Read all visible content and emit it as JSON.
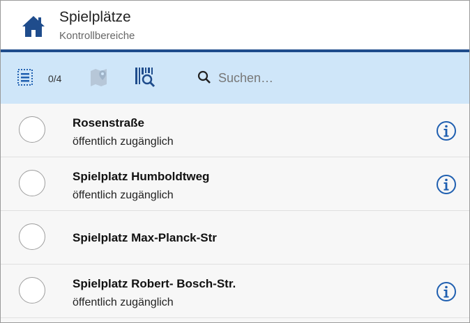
{
  "header": {
    "title": "Spielplätze",
    "subtitle": "Kontrollbereiche",
    "icon": "home-icon",
    "brand_color": "#1f4c8c"
  },
  "toolbar": {
    "counter": "0/4",
    "search_placeholder": "Suchen…",
    "background": "#cfe6f9",
    "icons": [
      "list-select-icon",
      "map-marker-icon",
      "barcode-scan-icon",
      "search-icon"
    ]
  },
  "items": [
    {
      "name": "Rosenstraße",
      "status": "öffentlich zugänglich",
      "selected": false,
      "has_info": true
    },
    {
      "name": "Spielplatz Humboldtweg",
      "status": "öffentlich zugänglich",
      "selected": false,
      "has_info": true
    },
    {
      "name": "Spielplatz Max-Planck-Str",
      "status": "",
      "selected": false,
      "has_info": false
    },
    {
      "name": "Spielplatz Robert- Bosch-Str.",
      "status": "öffentlich zugänglich",
      "selected": false,
      "has_info": true
    }
  ],
  "accent_color": "#1f5fb0"
}
